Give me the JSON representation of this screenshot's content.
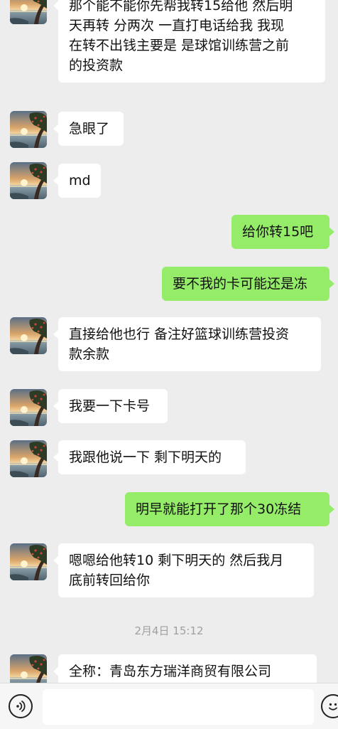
{
  "colors": {
    "background": "#ededed",
    "incoming_bubble": "#ffffff",
    "outgoing_bubble": "#95ec69",
    "timestamp_text": "#a0a0a0"
  },
  "messages": [
    {
      "direction": "in",
      "lines": [
        "那个能不能你先帮我转15给他 然后明",
        "天再转 分两次 一直打电话给我 我现",
        "在转不出钱主要是 是球馆训练营之前",
        "的投资款"
      ]
    },
    {
      "direction": "in",
      "lines": [
        "急眼了"
      ]
    },
    {
      "direction": "in",
      "lines": [
        "md"
      ]
    },
    {
      "direction": "out",
      "lines": [
        "给你转15吧"
      ]
    },
    {
      "direction": "out",
      "lines": [
        "要不我的卡可能还是冻"
      ]
    },
    {
      "direction": "in",
      "lines": [
        "直接给他也行 备注好篮球训练营投资",
        "款余款"
      ]
    },
    {
      "direction": "in",
      "lines": [
        "我要一下卡号"
      ]
    },
    {
      "direction": "in",
      "lines": [
        "我跟他说一下 剩下明天的"
      ]
    },
    {
      "direction": "out",
      "lines": [
        "明早就能打开了那个30冻结"
      ]
    },
    {
      "direction": "in",
      "lines": [
        "嗯嗯给他转10 剩下明天的 然后我月",
        "底前转回给你"
      ]
    },
    {
      "direction": "in",
      "lines": [
        "全称：青岛东方瑞洋商贸有限公司"
      ]
    }
  ],
  "timestamp": "2月4日 15:12",
  "input_bar": {
    "voice_icon": "voice-icon",
    "emoji_icon": "emoji-icon",
    "input_value": ""
  }
}
